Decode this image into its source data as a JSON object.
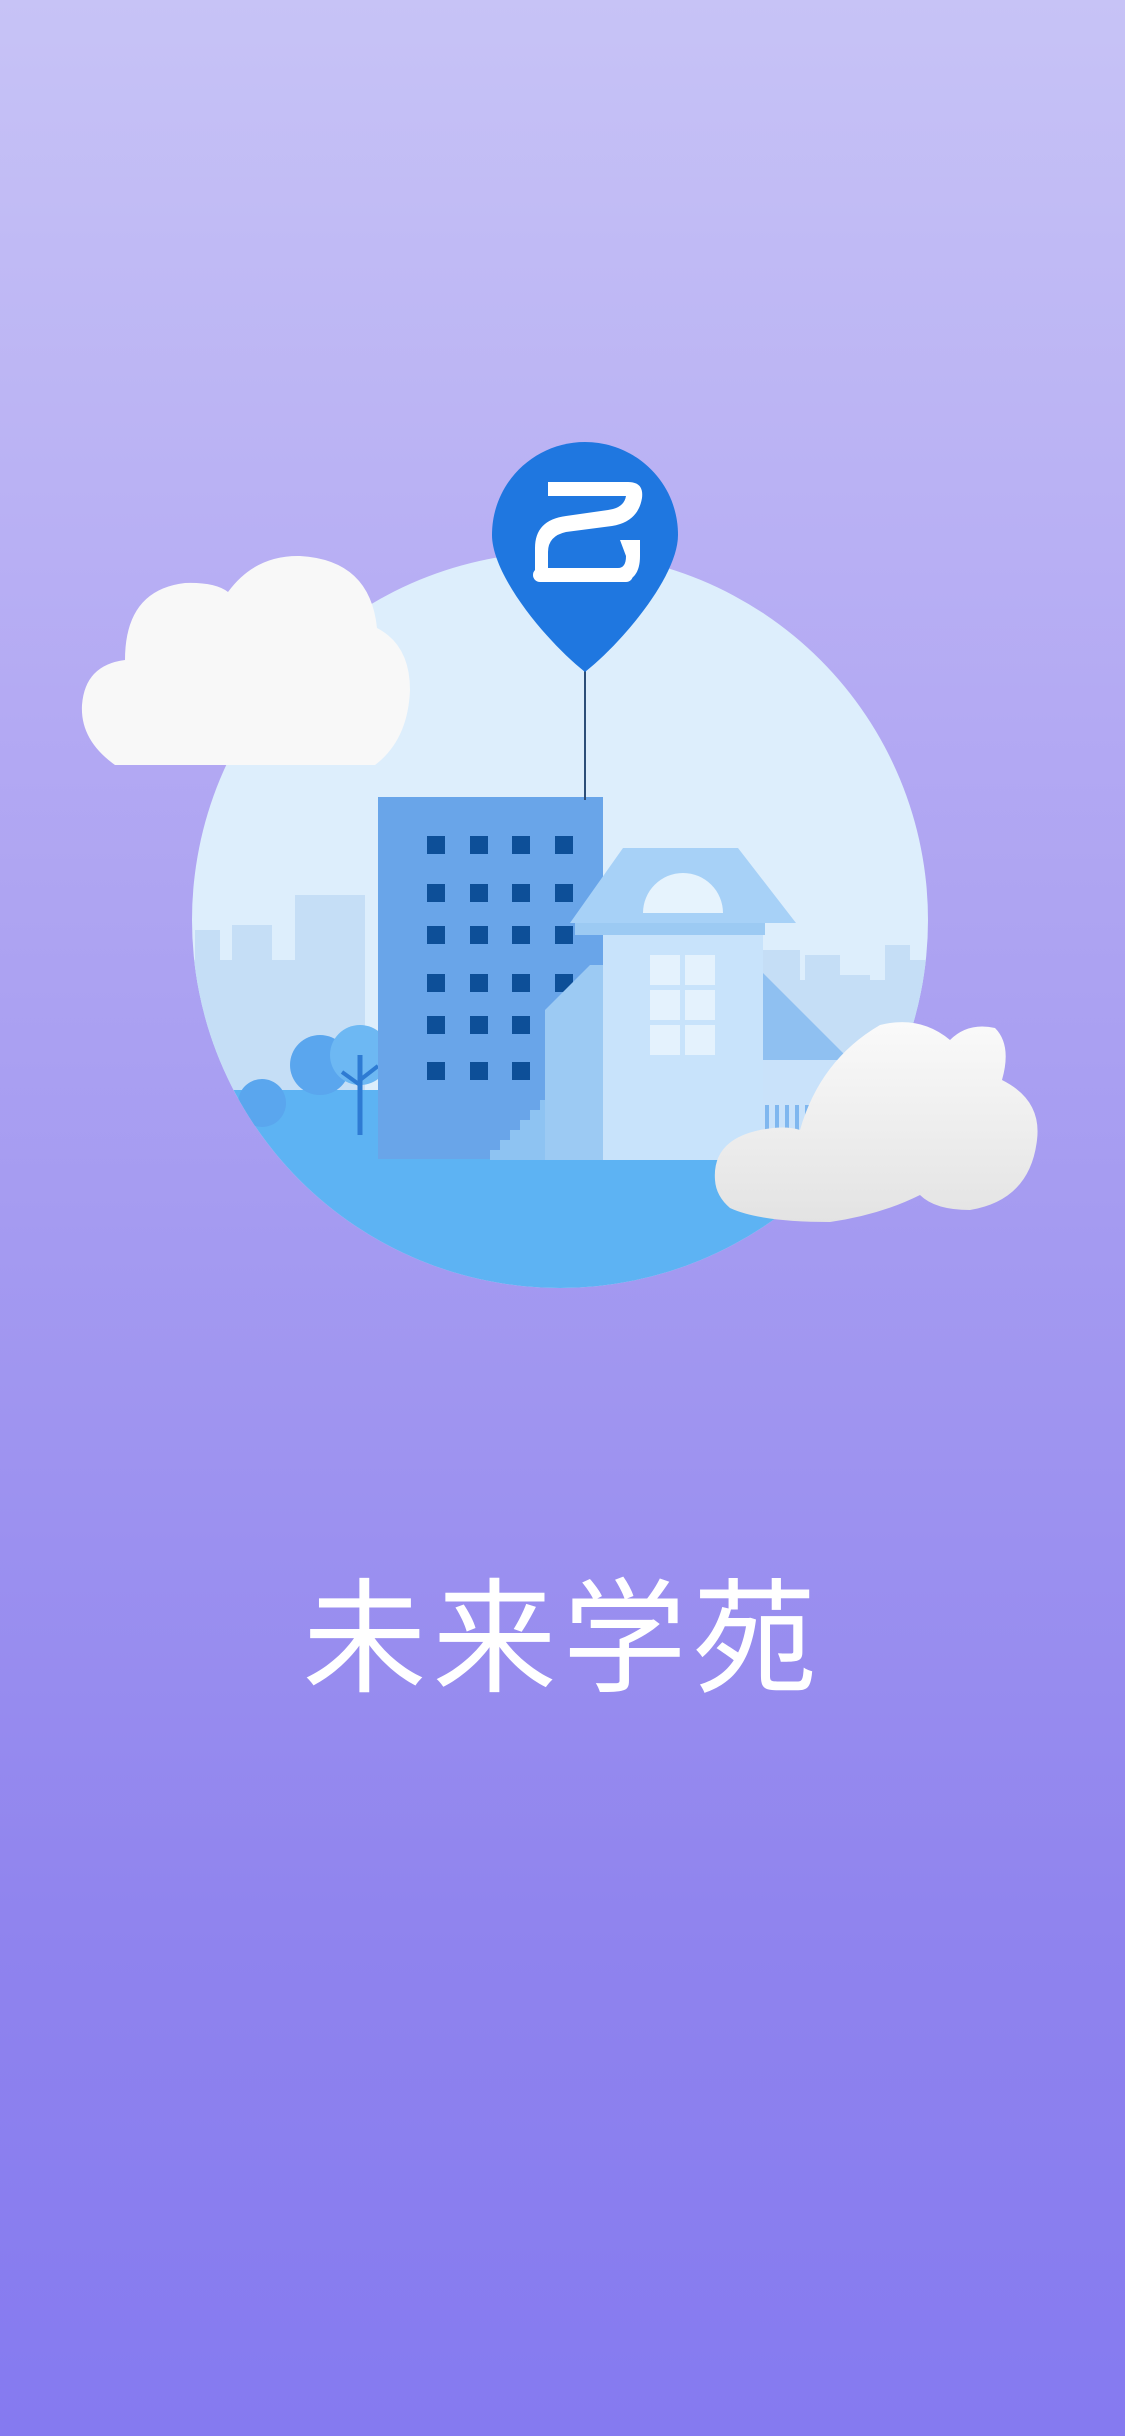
{
  "splash": {
    "title": "未来学苑",
    "logo_icon": "map-pin-logo-icon"
  },
  "colors": {
    "background_top": "#c7c3f6",
    "background_bottom": "#857af0",
    "pin_blue": "#1f77e0",
    "circle_light": "#ddeefc",
    "ground_blue": "#5db3f3"
  }
}
